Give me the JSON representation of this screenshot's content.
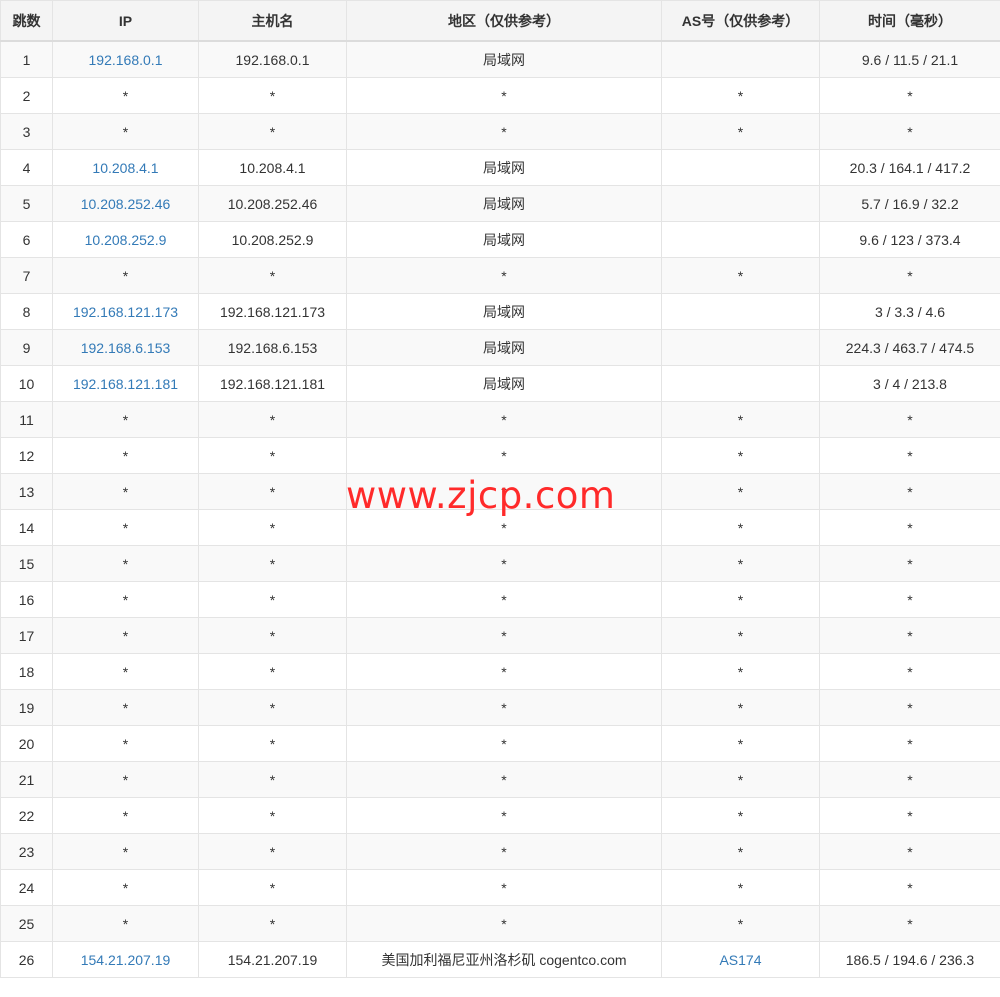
{
  "table": {
    "headers": [
      "跳数",
      "IP",
      "主机名",
      "地区（仅供参考）",
      "AS号（仅供参考）",
      "时间（毫秒）"
    ],
    "rows": [
      {
        "hop": "1",
        "ip": "192.168.0.1",
        "host": "192.168.0.1",
        "region": "局域网",
        "asn": "",
        "time": "9.6 / 11.5 / 21.1"
      },
      {
        "hop": "2",
        "ip": "*",
        "host": "*",
        "region": "*",
        "asn": "*",
        "time": "*"
      },
      {
        "hop": "3",
        "ip": "*",
        "host": "*",
        "region": "*",
        "asn": "*",
        "time": "*"
      },
      {
        "hop": "4",
        "ip": "10.208.4.1",
        "host": "10.208.4.1",
        "region": "局域网",
        "asn": "",
        "time": "20.3 / 164.1 / 417.2"
      },
      {
        "hop": "5",
        "ip": "10.208.252.46",
        "host": "10.208.252.46",
        "region": "局域网",
        "asn": "",
        "time": "5.7 / 16.9 / 32.2"
      },
      {
        "hop": "6",
        "ip": "10.208.252.9",
        "host": "10.208.252.9",
        "region": "局域网",
        "asn": "",
        "time": "9.6 / 123 / 373.4"
      },
      {
        "hop": "7",
        "ip": "*",
        "host": "*",
        "region": "*",
        "asn": "*",
        "time": "*"
      },
      {
        "hop": "8",
        "ip": "192.168.121.173",
        "host": "192.168.121.173",
        "region": "局域网",
        "asn": "",
        "time": "3 / 3.3 / 4.6"
      },
      {
        "hop": "9",
        "ip": "192.168.6.153",
        "host": "192.168.6.153",
        "region": "局域网",
        "asn": "",
        "time": "224.3 / 463.7 / 474.5"
      },
      {
        "hop": "10",
        "ip": "192.168.121.181",
        "host": "192.168.121.181",
        "region": "局域网",
        "asn": "",
        "time": "3 / 4 / 213.8"
      },
      {
        "hop": "11",
        "ip": "*",
        "host": "*",
        "region": "*",
        "asn": "*",
        "time": "*"
      },
      {
        "hop": "12",
        "ip": "*",
        "host": "*",
        "region": "*",
        "asn": "*",
        "time": "*"
      },
      {
        "hop": "13",
        "ip": "*",
        "host": "*",
        "region": "*",
        "asn": "*",
        "time": "*"
      },
      {
        "hop": "14",
        "ip": "*",
        "host": "*",
        "region": "*",
        "asn": "*",
        "time": "*"
      },
      {
        "hop": "15",
        "ip": "*",
        "host": "*",
        "region": "*",
        "asn": "*",
        "time": "*"
      },
      {
        "hop": "16",
        "ip": "*",
        "host": "*",
        "region": "*",
        "asn": "*",
        "time": "*"
      },
      {
        "hop": "17",
        "ip": "*",
        "host": "*",
        "region": "*",
        "asn": "*",
        "time": "*"
      },
      {
        "hop": "18",
        "ip": "*",
        "host": "*",
        "region": "*",
        "asn": "*",
        "time": "*"
      },
      {
        "hop": "19",
        "ip": "*",
        "host": "*",
        "region": "*",
        "asn": "*",
        "time": "*"
      },
      {
        "hop": "20",
        "ip": "*",
        "host": "*",
        "region": "*",
        "asn": "*",
        "time": "*"
      },
      {
        "hop": "21",
        "ip": "*",
        "host": "*",
        "region": "*",
        "asn": "*",
        "time": "*"
      },
      {
        "hop": "22",
        "ip": "*",
        "host": "*",
        "region": "*",
        "asn": "*",
        "time": "*"
      },
      {
        "hop": "23",
        "ip": "*",
        "host": "*",
        "region": "*",
        "asn": "*",
        "time": "*"
      },
      {
        "hop": "24",
        "ip": "*",
        "host": "*",
        "region": "*",
        "asn": "*",
        "time": "*"
      },
      {
        "hop": "25",
        "ip": "*",
        "host": "*",
        "region": "*",
        "asn": "*",
        "time": "*"
      },
      {
        "hop": "26",
        "ip": "154.21.207.19",
        "host": "154.21.207.19",
        "region": "美国加利福尼亚州洛杉矶 cogentco.com",
        "asn": "AS174",
        "time": "186.5 / 194.6 / 236.3"
      }
    ]
  },
  "watermark": {
    "text": "www.zjcp.com"
  },
  "colors": {
    "link": "#337ab7",
    "watermark": "#ff2a2a",
    "header_bg": "#f4f4f4",
    "stripe_bg": "#f9f9f9",
    "border": "#e4e4e4"
  }
}
